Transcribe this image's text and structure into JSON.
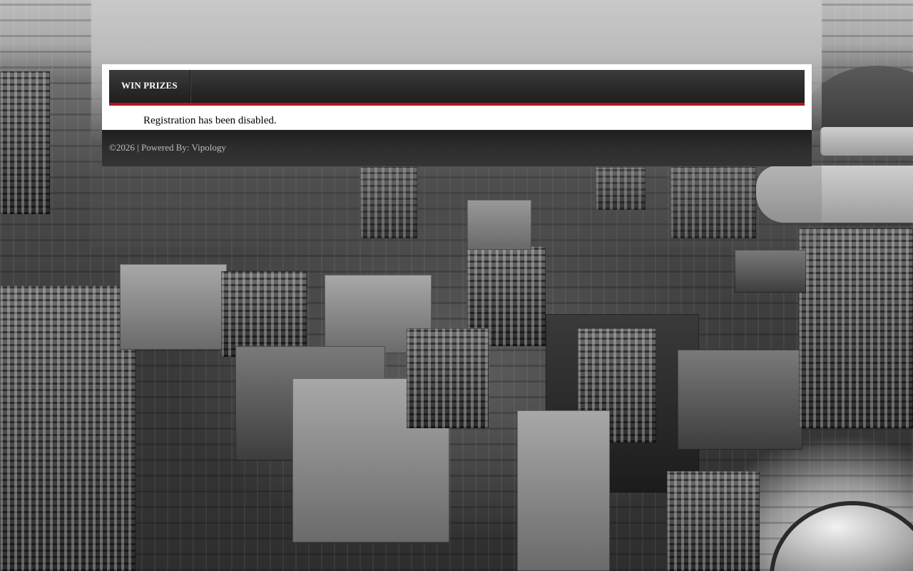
{
  "nav": {
    "items": [
      {
        "label": "WIN PRIZES"
      }
    ]
  },
  "content": {
    "message": "Registration has been disabled."
  },
  "footer": {
    "copyright": "©2026",
    "separator": " | ",
    "powered_by_label": "Powered By: ",
    "powered_by_name": "Vipology"
  },
  "colors": {
    "accent_red": "#b3151b",
    "nav_bg": "#2a2a2a",
    "panel_bg": "#ffffff"
  }
}
